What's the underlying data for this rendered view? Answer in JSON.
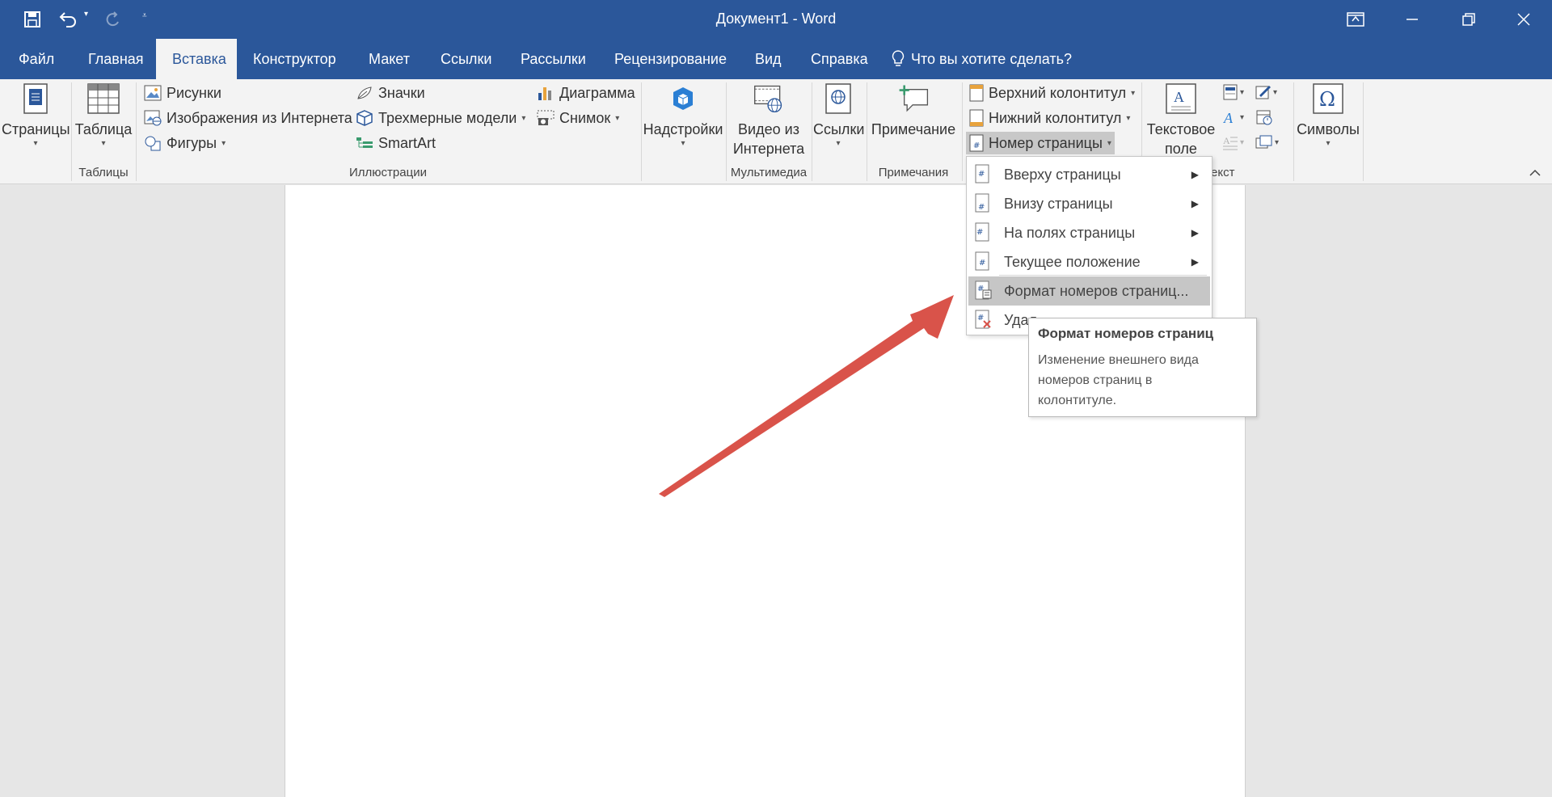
{
  "window": {
    "title": "Документ1  -  Word"
  },
  "tabs": [
    {
      "label": "Файл"
    },
    {
      "label": "Главная"
    },
    {
      "label": "Вставка"
    },
    {
      "label": "Конструктор"
    },
    {
      "label": "Макет"
    },
    {
      "label": "Ссылки"
    },
    {
      "label": "Рассылки"
    },
    {
      "label": "Рецензирование"
    },
    {
      "label": "Вид"
    },
    {
      "label": "Справка"
    }
  ],
  "tell_me": "Что вы хотите сделать?",
  "ribbon": {
    "pages": "Страницы",
    "table": "Таблица",
    "pictures": "Рисунки",
    "online_images": "Изображения из Интернета",
    "shapes": "Фигуры",
    "icons": "Значки",
    "models3d": "Трехмерные модели",
    "smartart": "SmartArt",
    "chart": "Диаграмма",
    "screenshot": "Снимок",
    "addins": "Надстройки",
    "video_line1": "Видео из",
    "video_line2": "Интернета",
    "links": "Ссылки",
    "comment": "Примечание",
    "header": "Верхний колонтитул",
    "footer": "Нижний колонтитул",
    "page_number": "Номер страницы",
    "textbox_line1": "Текстовое",
    "textbox_line2": "поле",
    "symbols": "Символы",
    "groups": {
      "tables": "Таблицы",
      "illustrations": "Иллюстрации",
      "media": "Мультимедиа",
      "comments": "Примечания",
      "text_partial": "екст"
    }
  },
  "menu": {
    "items": [
      {
        "label": "Вверху страницы",
        "submenu": true
      },
      {
        "label": "Внизу страницы",
        "submenu": true
      },
      {
        "label": "На полях страницы",
        "submenu": true
      },
      {
        "label": "Текущее положение",
        "submenu": true
      },
      {
        "label": "Формат номеров страниц...",
        "submenu": false
      },
      {
        "label": "Удал",
        "submenu": false
      }
    ]
  },
  "tooltip": {
    "title": "Формат номеров страниц",
    "text_line1": "Изменение внешнего вида",
    "text_line2": "номеров страниц в",
    "text_line3": "колонтитуле."
  },
  "colors": {
    "brand": "#2b579a",
    "annotation_arrow": "#d9534a"
  }
}
